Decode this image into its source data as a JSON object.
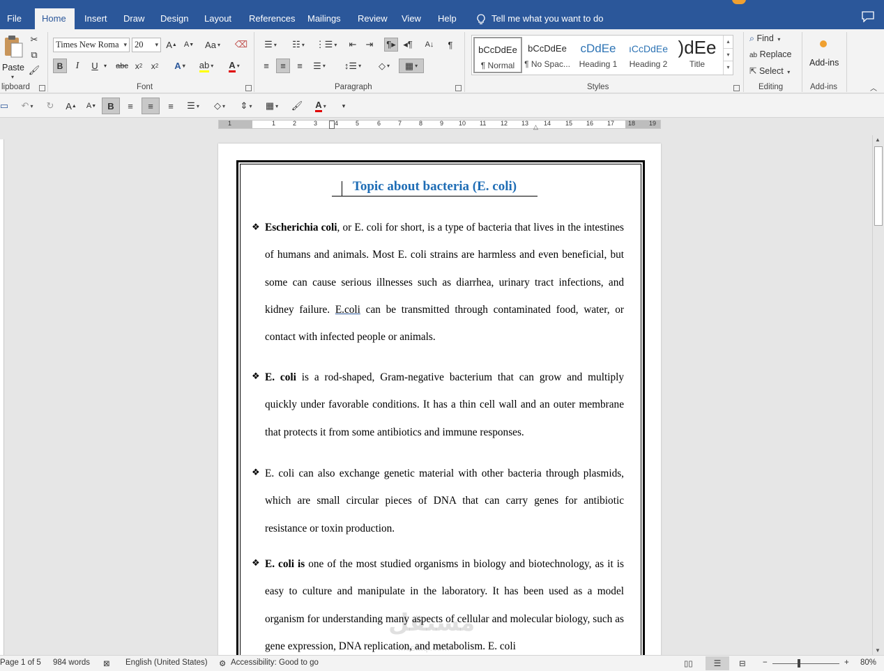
{
  "tabs": [
    "File",
    "Home",
    "Insert",
    "Draw",
    "Design",
    "Layout",
    "References",
    "Mailings",
    "Review",
    "View",
    "Help"
  ],
  "active_tab": "Home",
  "tell_me": "Tell me what you want to do",
  "groups": {
    "clipboard": "lipboard",
    "font": "Font",
    "paragraph": "Paragraph",
    "styles": "Styles",
    "editing": "Editing",
    "addins": "Add-ins"
  },
  "clipboard": {
    "paste_label": "Paste"
  },
  "font": {
    "name": "Times New Roma",
    "size": "20",
    "case_label": "Aa"
  },
  "styles": [
    {
      "preview": "bCcDdEe",
      "name": "¶ Normal"
    },
    {
      "preview": "bCcDdEe",
      "name": "¶ No Spac..."
    },
    {
      "preview": "cDdEe",
      "name": "Heading 1"
    },
    {
      "preview": "ıCcDdEe",
      "name": "Heading 2"
    },
    {
      "preview": ")dEe",
      "name": "Title"
    }
  ],
  "editing": {
    "find": "Find",
    "replace": "Replace",
    "select": "Select"
  },
  "addins": {
    "label": "Add-ins"
  },
  "ruler_numbers": [
    "1",
    "1",
    "2",
    "3",
    "4",
    "5",
    "6",
    "7",
    "8",
    "9",
    "10",
    "11",
    "12",
    "13",
    "14",
    "15",
    "16",
    "17",
    "18",
    "19"
  ],
  "document": {
    "title": "Topic about bacteria  (E. coli)",
    "paragraphs": [
      {
        "bold": "Escherichia coli",
        "text": ", or E. coli for short, is a type of bacteria that lives in the intestines of humans and animals. Most E. coli strains are harmless and even beneficial, but some can cause serious illnesses such as diarrhea, urinary tract infections, and kidney failure. ",
        "underlined": "E.coli",
        "tail": " can be transmitted through contaminated food, water, or contact with infected people or animals."
      },
      {
        "bold": "E. coli",
        "text": " is a rod-shaped, Gram-negative bacterium that can grow and multiply quickly under favorable conditions. It has a thin cell wall and an outer membrane that protects it from some antibiotics and immune responses."
      },
      {
        "bold": "",
        "text": "E. coli can also exchange genetic material with other bacteria through plasmids, which are small circular pieces of DNA that can carry genes for antibiotic resistance or toxin production."
      },
      {
        "bold": "E. coli is",
        "text": " one of the most studied organisms in biology and biotechnology, as it is easy to culture and manipulate in the laboratory. It has been used as a model organism for understanding many aspects of cellular and molecular biology, such as gene expression, DNA replication, and metabolism. E. coli"
      }
    ],
    "watermark": "مستقل",
    "watermark_sub": "mostaql.com"
  },
  "status": {
    "page": "Page 1 of 5",
    "words": "984 words",
    "language": "English (United States)",
    "accessibility": "Accessibility: Good to go",
    "zoom": "80%"
  }
}
